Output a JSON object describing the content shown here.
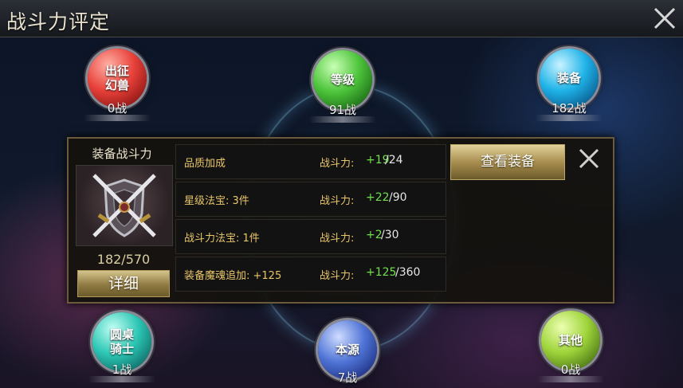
{
  "header": {
    "title": "战斗力评定"
  },
  "orbs": [
    {
      "label": "出征\n幻兽",
      "value": "0战",
      "color": "red"
    },
    {
      "label": "等级",
      "value": "91战",
      "color": "green"
    },
    {
      "label": "装备",
      "value": "182战",
      "color": "blue"
    },
    {
      "label": "圆桌\n骑士",
      "value": "1战",
      "color": "cyan"
    },
    {
      "label": "本源",
      "value": "7战",
      "color": "indigo"
    },
    {
      "label": "其他",
      "value": "0战",
      "color": "lime"
    }
  ],
  "panel": {
    "equip_title": "装备战斗力",
    "equip_value": "182/570",
    "detail_button": "详细",
    "view_button": "查看装备",
    "power_label": "战斗力:",
    "rows": [
      {
        "label": "品质加成",
        "current": "+19",
        "max": "/24"
      },
      {
        "label": "星级法宝: 3件",
        "current": "+22",
        "max": "/90"
      },
      {
        "label": "战斗力法宝: 1件",
        "current": "+2",
        "max": "/30"
      },
      {
        "label": "装备魔魂追加: +125",
        "current": "+125",
        "max": "/360"
      }
    ]
  },
  "icons": {
    "close": "close-icon",
    "equipment_emblem": "crossed-swords-shield-icon"
  }
}
